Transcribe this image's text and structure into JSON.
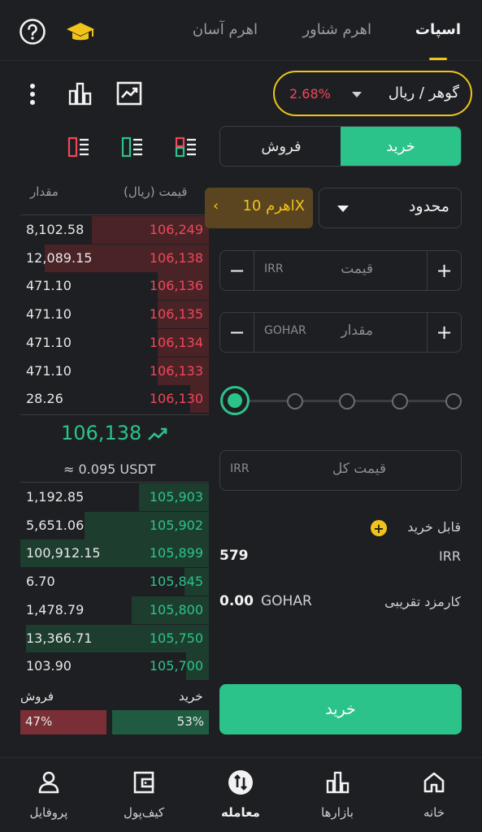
{
  "header": {
    "tabs": [
      {
        "label": "اسپات",
        "active": true
      },
      {
        "label": "اهرم شناور",
        "active": false
      },
      {
        "label": "اهرم آسان",
        "active": false
      }
    ],
    "icons": [
      "help-icon",
      "academy-icon"
    ]
  },
  "pair": {
    "name": "گوهر / ریال",
    "change": "2.68%",
    "change_color": "#f0475a"
  },
  "toolbar_icons": [
    "more-icon",
    "depth-chart-icon",
    "line-chart-icon"
  ],
  "book_layout_icons": [
    "layout-both-icon",
    "layout-bids-icon",
    "layout-asks-icon"
  ],
  "side_toggle": {
    "buy": "خرید",
    "sell": "فروش"
  },
  "order_book": {
    "header_price": "قیمت (ریال)",
    "header_amount": "مقدار",
    "asks": [
      {
        "qty": "8,102.58",
        "price": "106,249",
        "depth": 0.62
      },
      {
        "qty": "12,089.15",
        "price": "106,138",
        "depth": 0.87
      },
      {
        "qty": "471.10",
        "price": "106,136",
        "depth": 0.27
      },
      {
        "qty": "471.10",
        "price": "106,135",
        "depth": 0.27
      },
      {
        "qty": "471.10",
        "price": "106,134",
        "depth": 0.27
      },
      {
        "qty": "471.10",
        "price": "106,133",
        "depth": 0.27
      },
      {
        "qty": "28.26",
        "price": "106,130",
        "depth": 0.1
      }
    ],
    "last_price": "106,138",
    "last_price_usdt": "≈ 0.095 USDT",
    "bids": [
      {
        "qty": "1,192.85",
        "price": "105,903",
        "depth": 0.37
      },
      {
        "qty": "5,651.06",
        "price": "105,902",
        "depth": 0.66
      },
      {
        "qty": "100,912.15",
        "price": "105,899",
        "depth": 1.0
      },
      {
        "qty": "6.70",
        "price": "105,845",
        "depth": 0.13
      },
      {
        "qty": "1,478.79",
        "price": "105,800",
        "depth": 0.41
      },
      {
        "qty": "13,366.71",
        "price": "105,750",
        "depth": 0.97
      },
      {
        "qty": "103.90",
        "price": "105,700",
        "depth": 0.12
      }
    ],
    "buy_label": "خرید",
    "sell_label": "فروش",
    "buy_pct": "53%",
    "sell_pct": "47%"
  },
  "order_form": {
    "order_type": "محدود",
    "leverage": "اهرم 10X",
    "price_placeholder": "قیمت",
    "price_unit": "IRR",
    "amount_placeholder": "مقدار",
    "amount_unit": "GOHAR",
    "slider_value_pct": 0,
    "total_placeholder": "قیمت کل",
    "total_unit": "IRR",
    "available_label": "قابل خرید",
    "available_currency": "IRR",
    "available_value": "579",
    "fee_label": "کارمزد تقریبی",
    "fee_currency": "GOHAR",
    "fee_value": "0.00",
    "submit": "خرید"
  },
  "colors": {
    "buy": "#2cc38a",
    "sell": "#f0475a",
    "accent": "#f0c419"
  },
  "bottom_nav": [
    {
      "label": "خانه",
      "icon": "home-icon",
      "active": false
    },
    {
      "label": "بازارها",
      "icon": "markets-icon",
      "active": false
    },
    {
      "label": "معامله",
      "icon": "trade-icon",
      "active": true
    },
    {
      "label": "کیف‌پول",
      "icon": "wallet-icon",
      "active": false
    },
    {
      "label": "پروفایل",
      "icon": "profile-icon",
      "active": false
    }
  ]
}
